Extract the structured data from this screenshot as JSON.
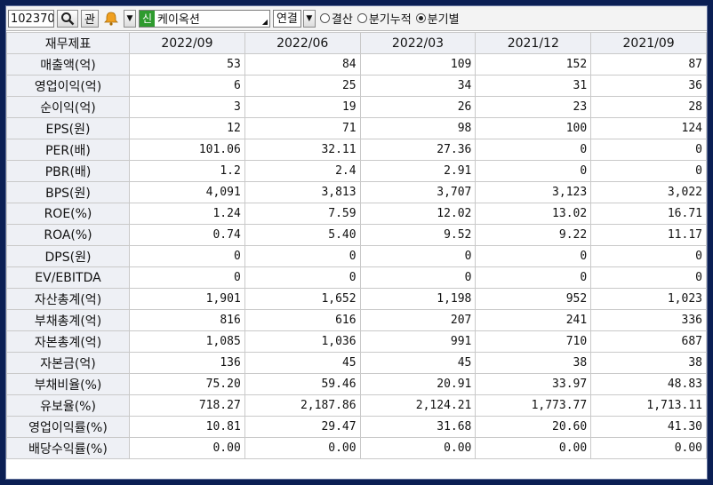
{
  "toolbar": {
    "code": "102370",
    "gwan_label": "관",
    "new_badge": "신",
    "company_name": "케이옥션",
    "consolidation": "연결",
    "radio_options": [
      "결산",
      "분기누적",
      "분기별"
    ],
    "radio_selected": "분기별"
  },
  "table": {
    "header_label": "재무제표",
    "periods": [
      "2022/09",
      "2022/06",
      "2022/03",
      "2021/12",
      "2021/09"
    ],
    "rows": [
      {
        "label": "매출액(억)",
        "values": [
          "53",
          "84",
          "109",
          "152",
          "87"
        ]
      },
      {
        "label": "영업이익(억)",
        "values": [
          "6",
          "25",
          "34",
          "31",
          "36"
        ]
      },
      {
        "label": "순이익(억)",
        "values": [
          "3",
          "19",
          "26",
          "23",
          "28"
        ]
      },
      {
        "label": "EPS(원)",
        "values": [
          "12",
          "71",
          "98",
          "100",
          "124"
        ]
      },
      {
        "label": "PER(배)",
        "values": [
          "101.06",
          "32.11",
          "27.36",
          "0",
          "0"
        ]
      },
      {
        "label": "PBR(배)",
        "values": [
          "1.2",
          "2.4",
          "2.91",
          "0",
          "0"
        ]
      },
      {
        "label": "BPS(원)",
        "values": [
          "4,091",
          "3,813",
          "3,707",
          "3,123",
          "3,022"
        ]
      },
      {
        "label": "ROE(%)",
        "values": [
          "1.24",
          "7.59",
          "12.02",
          "13.02",
          "16.71"
        ]
      },
      {
        "label": "ROA(%)",
        "values": [
          "0.74",
          "5.40",
          "9.52",
          "9.22",
          "11.17"
        ]
      },
      {
        "label": "DPS(원)",
        "values": [
          "0",
          "0",
          "0",
          "0",
          "0"
        ]
      },
      {
        "label": "EV/EBITDA",
        "values": [
          "0",
          "0",
          "0",
          "0",
          "0"
        ]
      },
      {
        "label": "자산총계(억)",
        "values": [
          "1,901",
          "1,652",
          "1,198",
          "952",
          "1,023"
        ]
      },
      {
        "label": "부채총계(억)",
        "values": [
          "816",
          "616",
          "207",
          "241",
          "336"
        ]
      },
      {
        "label": "자본총계(억)",
        "values": [
          "1,085",
          "1,036",
          "991",
          "710",
          "687"
        ]
      },
      {
        "label": "자본금(억)",
        "values": [
          "136",
          "45",
          "45",
          "38",
          "38"
        ]
      },
      {
        "label": "부채비율(%)",
        "values": [
          "75.20",
          "59.46",
          "20.91",
          "33.97",
          "48.83"
        ]
      },
      {
        "label": "유보율(%)",
        "values": [
          "718.27",
          "2,187.86",
          "2,124.21",
          "1,773.77",
          "1,713.11"
        ]
      },
      {
        "label": "영업이익률(%)",
        "values": [
          "10.81",
          "29.47",
          "31.68",
          "20.60",
          "41.30"
        ]
      },
      {
        "label": "배당수익률(%)",
        "values": [
          "0.00",
          "0.00",
          "0.00",
          "0.00",
          "0.00"
        ]
      }
    ]
  }
}
